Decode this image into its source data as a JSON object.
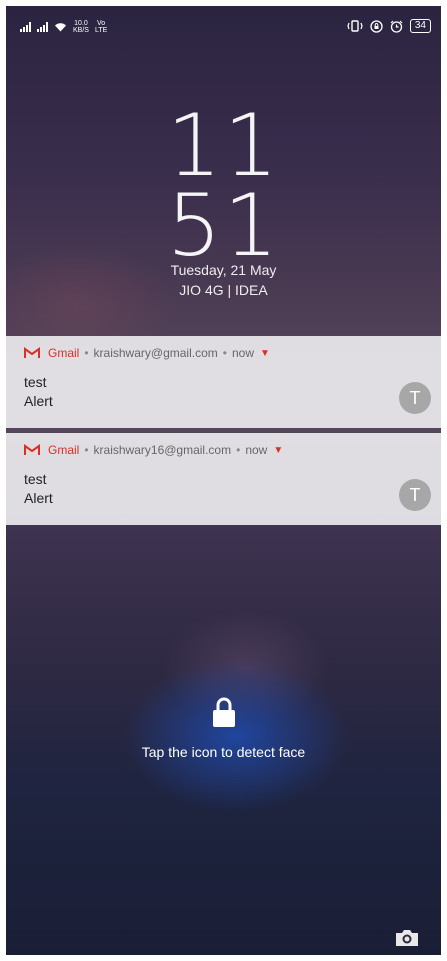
{
  "statusbar": {
    "net_speed": "10.0",
    "net_unit": "KB/S",
    "volte": "Vo",
    "lte": "LTE",
    "battery": "34"
  },
  "lockscreen": {
    "clock_hours": "11",
    "clock_minutes": "51",
    "date": "Tuesday, 21 May",
    "carrier": "JIO 4G | IDEA",
    "unlock_hint": "Tap the icon to detect face"
  },
  "notifications": [
    {
      "app": "Gmail",
      "account": "kraishwary@gmail.com",
      "time": "now",
      "title": "test",
      "body": "Alert",
      "avatar": "T"
    },
    {
      "app": "Gmail",
      "account": "kraishwary16@gmail.com",
      "time": "now",
      "title": "test",
      "body": "Alert",
      "avatar": "T"
    }
  ],
  "icons": {
    "signal": "signal-bars-icon",
    "wifi": "wifi-icon",
    "vibrate": "vibrate-icon",
    "rotation_lock": "rotation-lock-icon",
    "alarm": "alarm-icon",
    "gmail": "gmail-icon",
    "lock": "lock-icon",
    "camera": "camera-icon"
  },
  "colors": {
    "gmail_red": "#d93025",
    "avatar_gray": "#a7a7a7"
  }
}
